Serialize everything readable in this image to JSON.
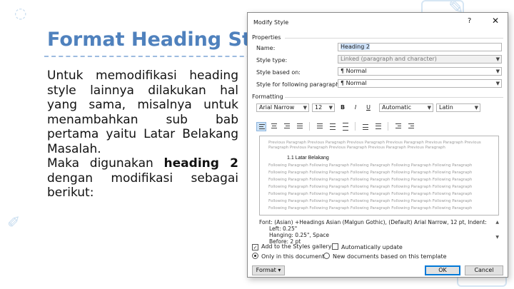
{
  "slide": {
    "title": "Format Heading Style",
    "body_lines": [
      "Untuk memodifikasi heading style lainnya dilakukan hal yang sama, misalnya untuk menambahkan sub bab pertama yaitu Latar Belakang Masalah."
    ],
    "body_2_prefix": "Maka digunakan ",
    "body_2_bold": "heading 2",
    "body_2_suffix": " dengan modifikasi sebagai berikut:"
  },
  "dialog": {
    "title": "Modify Style",
    "help": "?",
    "close": "✕",
    "properties_label": "Properties",
    "name_label": "Name:",
    "name_value": "Heading 2",
    "style_type_label": "Style type:",
    "style_type_value": "Linked (paragraph and character)",
    "based_on_label": "Style based on:",
    "based_on_value": "¶ Normal",
    "following_label": "Style for following paragraph:",
    "following_value": "¶ Normal",
    "formatting_label": "Formatting",
    "font_value": "Arial Narrow",
    "size_value": "12",
    "bold": "B",
    "italic": "I",
    "underline": "U",
    "color_value": "Automatic",
    "language_value": "Latin",
    "preview": {
      "prev_line_1": "Previous Paragraph Previous Paragraph Previous Paragraph Previous Paragraph Previous Paragraph Previous",
      "prev_line_2": "Paragraph Previous Paragraph Previous Paragraph Previous Paragraph Previous Paragraph",
      "heading_text": "1.1 Latar Belakang",
      "follow_line": "Following Paragraph Following Paragraph Following Paragraph Following Paragraph Following Paragraph"
    },
    "description_lines": [
      "Font: (Asian) +Headings Asian (Malgun Gothic), (Default) Arial Narrow, 12 pt, Indent:",
      "Left: 0.25\"",
      "Hanging: 0.25\", Space",
      "Before: 2 pt"
    ],
    "add_to_gallery_label": "Add to the Styles gallery",
    "auto_update_label": "Automatically update",
    "only_this_doc_label": "Only in this document",
    "new_docs_label": "New documents based on this template",
    "format_button": "Format ▾",
    "ok_button": "OK",
    "cancel_button": "Cancel"
  },
  "colors": {
    "title_blue": "#4f81bd",
    "selection": "#cfe3fb"
  }
}
